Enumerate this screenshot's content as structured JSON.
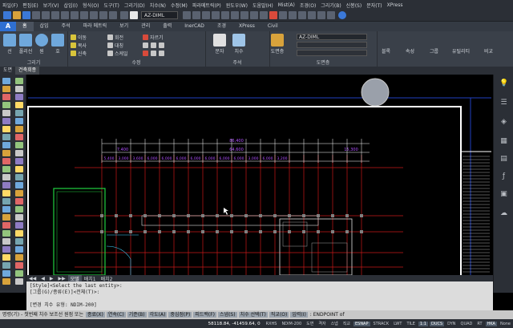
{
  "menubar": [
    "파일(F)",
    "편집(E)",
    "보기(V)",
    "삽입(I)",
    "형식(O)",
    "도구(T)",
    "그리기(D)",
    "치수(N)",
    "수정(M)",
    "파라메트릭(P)",
    "윈도우(W)",
    "도움말(H)",
    "Mist(A)",
    "조경(O)",
    "그리기(B)",
    "신봉(S)",
    "문자(T)",
    "XPress"
  ],
  "qat": {
    "layer": "AZ-DIML"
  },
  "tabs": {
    "app": "A",
    "items": [
      "홈",
      "삽입",
      "주석",
      "파라 메트릭",
      "보기",
      "관리",
      "출력",
      "InerCAD",
      "조경",
      "XPress",
      "Civil"
    ],
    "active": 0
  },
  "ribbon": {
    "draw": {
      "label": "그리기",
      "tools": [
        "선",
        "폴리선",
        "원",
        "호"
      ]
    },
    "modify": {
      "label": "수정",
      "items": [
        "이동",
        "회전",
        "복사",
        "대칭",
        "신축",
        "스케일"
      ],
      "edit": "자르기"
    },
    "annotation": {
      "label": "주석",
      "text": "문자",
      "dim": "치수"
    },
    "layers": {
      "label": "도면층",
      "current": "AZ-DIML",
      "layer_btn": "도면층"
    },
    "right": [
      "블록",
      "속성",
      "그룹",
      "유틸리티",
      "비교"
    ]
  },
  "doctabs": {
    "items": [
      "도면",
      "건축회종"
    ],
    "active": 1
  },
  "layouttabs": [
    "모델",
    "배치1",
    "배치2"
  ],
  "canvas": {
    "dim_top": "86,400",
    "dim_mid": [
      "7,400",
      "64,600",
      "15,300"
    ],
    "dim_bays": [
      "5,400",
      "3,000",
      "3,600",
      "6,000",
      "6,000",
      "6,000",
      "6,000",
      "6,000",
      "6,000",
      "6,000",
      "3,000",
      "6,000",
      "3,200"
    ]
  },
  "cmd": {
    "lines": [
      "[Style]<Select the last entity>:",
      "[그룹(G)/종류(E)]<전체(T)>:",
      "",
      "[변경 치수 유형: NDIM-200]"
    ]
  },
  "prompt": {
    "text": "명령(기) - 첫번째 치수 보조선 원점 또는",
    "options": [
      "종료(X)",
      "연속(C)",
      "기준(B)",
      "각도(A)",
      "중심점(P)",
      "피드백(F)",
      "스냅(S)",
      "치수 선택(T)",
      "직교(O)",
      "입력(I)"
    ],
    "tail": ": ENDPOINT of"
  },
  "status": {
    "coords": "58118.84, -41459.64, 0",
    "items": [
      "RXHS",
      "NDIM-200",
      "도면",
      "격자",
      "스냅",
      "직교",
      "ESNAP",
      "STRACK",
      "LWT",
      "TILE",
      "1:1",
      "DUCS",
      "DYN",
      "QUAD",
      "RT",
      "HKA",
      "None"
    ],
    "on": [
      "ESNAP",
      "1:1",
      "DUCS",
      "HKA"
    ]
  }
}
